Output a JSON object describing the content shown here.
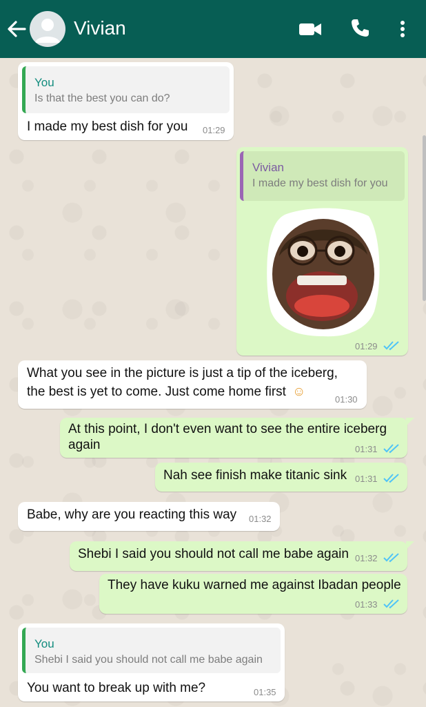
{
  "header": {
    "contact_name": "Vivian",
    "icons": [
      "back-arrow-icon",
      "avatar-icon",
      "video-call-icon",
      "phone-icon",
      "more-vertical-icon"
    ]
  },
  "colors": {
    "header": "#075e54",
    "outgoing": "#dcf8c6",
    "incoming": "#ffffff",
    "read_ticks": "#4fc3f7"
  },
  "messages": [
    {
      "dir": "in",
      "quote_author": "You",
      "quote_text": "Is that the best you can do?",
      "text": "I made my best dish for you",
      "time": "01:29"
    },
    {
      "dir": "out",
      "quote_author": "Vivian",
      "quote_text": "I made my best dish for you",
      "media": "sticker",
      "time": "01:29"
    },
    {
      "dir": "in",
      "text_line1": "What you see in the picture is just a tip of the iceberg,",
      "text_line2": "the best is yet to come. Just come home first",
      "emoji": "☺",
      "time": "01:30"
    },
    {
      "dir": "out",
      "text_line1": "At this point, I don't even want to see the entire iceberg",
      "text_line2": "again",
      "time": "01:31"
    },
    {
      "dir": "out",
      "text": "Nah see finish make titanic sink",
      "time": "01:31"
    },
    {
      "dir": "in",
      "text": "Babe, why are you reacting this way",
      "time": "01:32"
    },
    {
      "dir": "out",
      "text": "Shebi I said you should not call me babe again",
      "time": "01:32"
    },
    {
      "dir": "out",
      "text": "They have kuku warned me against Ibadan people",
      "time": "01:33"
    },
    {
      "dir": "in",
      "quote_author": "You",
      "quote_text": "Shebi I said you should not call me babe again",
      "text": "You want to break up with me?",
      "time": "01:35"
    }
  ]
}
